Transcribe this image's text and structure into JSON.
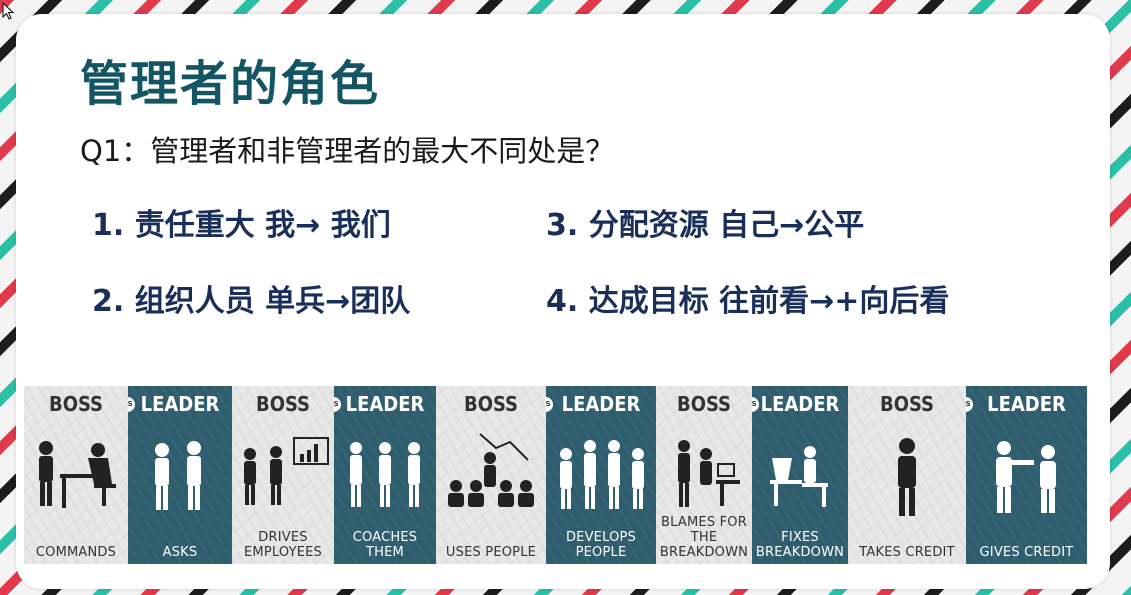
{
  "slide": {
    "title": "管理者的角色",
    "question": "Q1：管理者和非管理者的最大不同处是？",
    "points": [
      "1. 责任重大 我→ 我们",
      "2. 组织人员 单兵→团队",
      "3. 分配资源 自己→公平",
      "4. 达成目标 往前看→+向后看"
    ]
  },
  "comparison": {
    "boss_label": "BOSS",
    "leader_label": "LEADER",
    "vs_label": "VS",
    "pairs": [
      {
        "boss": "COMMANDS",
        "leader": "ASKS"
      },
      {
        "boss": "DRIVES EMPLOYEES",
        "leader": "COACHES THEM"
      },
      {
        "boss": "USES PEOPLE",
        "leader": "DEVELOPS PEOPLE"
      },
      {
        "boss": "BLAMES FOR THE BREAKDOWN",
        "leader": "FIXES BREAKDOWN"
      },
      {
        "boss": "TAKES CREDIT",
        "leader": "GIVES CREDIT"
      }
    ]
  },
  "colors": {
    "title": "#135563",
    "points": "#1a2e5a",
    "leader_panel": "#2e5d6e",
    "boss_panel": "#e8e8e8"
  },
  "icons": [
    "cursor-arrow-icon",
    "boss-figure-icon",
    "leader-figure-icon",
    "vs-badge-icon"
  ]
}
